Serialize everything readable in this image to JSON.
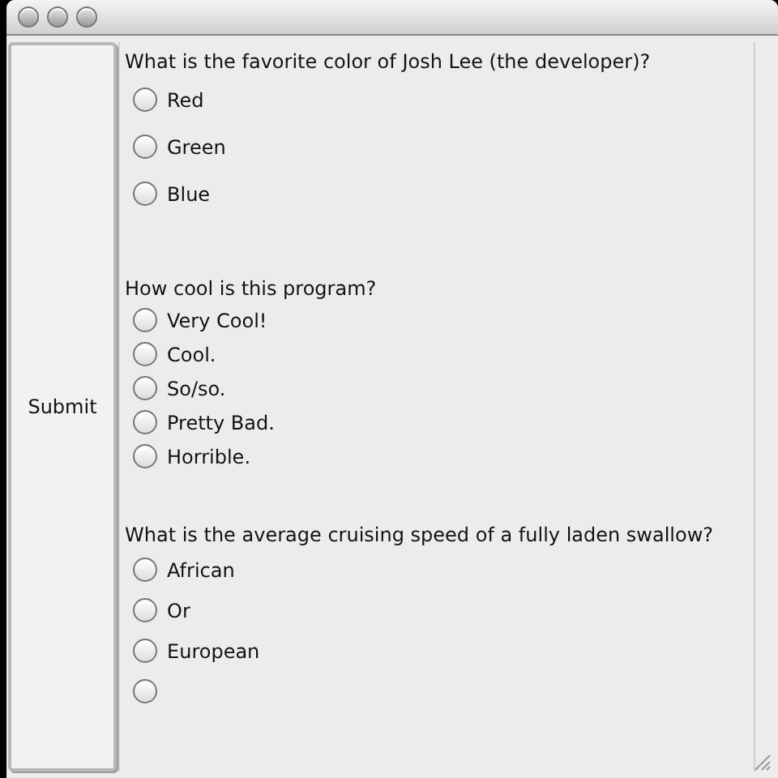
{
  "submit_button": {
    "label": "Submit"
  },
  "questions": [
    {
      "prompt": "What is the favorite color of Josh Lee (the developer)?",
      "options": [
        {
          "label": "Red",
          "selected": false
        },
        {
          "label": "Green",
          "selected": false
        },
        {
          "label": "Blue",
          "selected": false
        }
      ]
    },
    {
      "prompt": "How cool is this program?",
      "options": [
        {
          "label": "Very Cool!",
          "selected": false
        },
        {
          "label": "Cool.",
          "selected": false
        },
        {
          "label": "So/so.",
          "selected": false
        },
        {
          "label": "Pretty Bad.",
          "selected": false
        },
        {
          "label": "Horrible.",
          "selected": false
        }
      ]
    },
    {
      "prompt": "What is the average cruising speed of a fully laden swallow?",
      "options": [
        {
          "label": "African",
          "selected": false
        },
        {
          "label": "Or",
          "selected": false
        },
        {
          "label": "European",
          "selected": false
        },
        {
          "selected": false
        }
      ]
    }
  ]
}
